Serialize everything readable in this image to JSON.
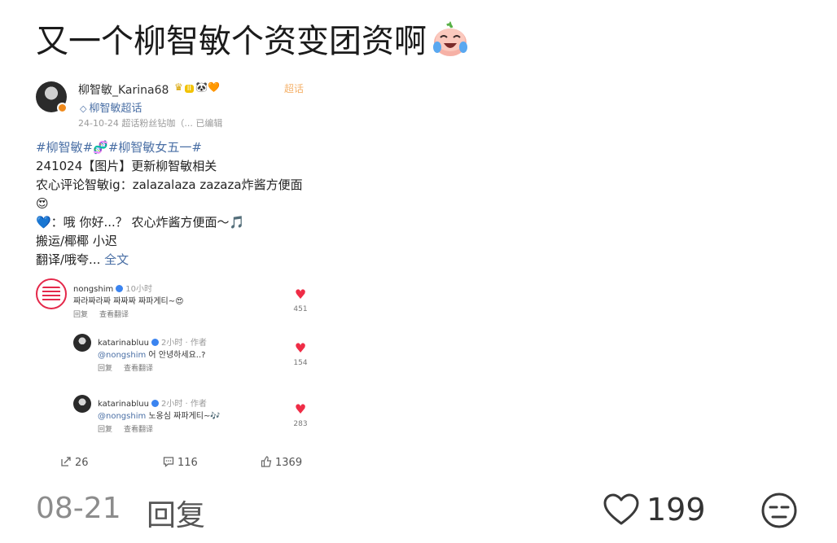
{
  "title": {
    "text": "又一个柳智敏个资变团资啊",
    "emoji": "laughing-crying-peach-emoji"
  },
  "post": {
    "user_name": "柳智敏_Karina68",
    "user_level": "II",
    "supertopic_badge": "超话",
    "topic": "柳智敏超话",
    "meta": "24-10-24  超话粉丝钻咖（...  已编辑",
    "tags": "#柳智敏#🧬#柳智敏女五一#",
    "line1": "241024【图片】更新柳智敏相关",
    "line2": "农心评论智敏ig：zalazalaza zazaza炸酱方便面",
    "line2_emoji": "😍",
    "line3": "💙：哦 你好...？ 农心炸酱方便面～🎵",
    "line4": "搬运/椰椰 小迟",
    "line5": "翻译/哦夸...",
    "full_text_link": "全文"
  },
  "comments": [
    {
      "name": "nongshim",
      "time": "10小时",
      "author_tag": "",
      "mention": "",
      "text": "짜라짜라짜 짜짜짜 짜파게티~😍",
      "reply": "回复",
      "view_translation": "查看翻译",
      "likes": "451"
    },
    {
      "name": "katarinabluu",
      "time": "2小时 · 作者",
      "author_tag": "作者",
      "mention": "@nongshim",
      "text": " 어 안녕하세요..?",
      "reply": "回复",
      "view_translation": "查看翻译",
      "likes": "154"
    },
    {
      "name": "katarinabluu",
      "time": "2小时 · 作者",
      "author_tag": "作者",
      "mention": "@nongshim",
      "text": " 노옹심 짜파게티~🎶",
      "reply": "回复",
      "view_translation": "查看翻译",
      "likes": "283"
    }
  ],
  "stats": {
    "reposts": "26",
    "comments": "116",
    "likes": "1369"
  },
  "footer": {
    "time": "08-21",
    "reply": "回复",
    "likes": "199"
  },
  "colors": {
    "link": "#4a6fa5",
    "heart": "#ef2c46",
    "muted": "#8c8c8c"
  }
}
